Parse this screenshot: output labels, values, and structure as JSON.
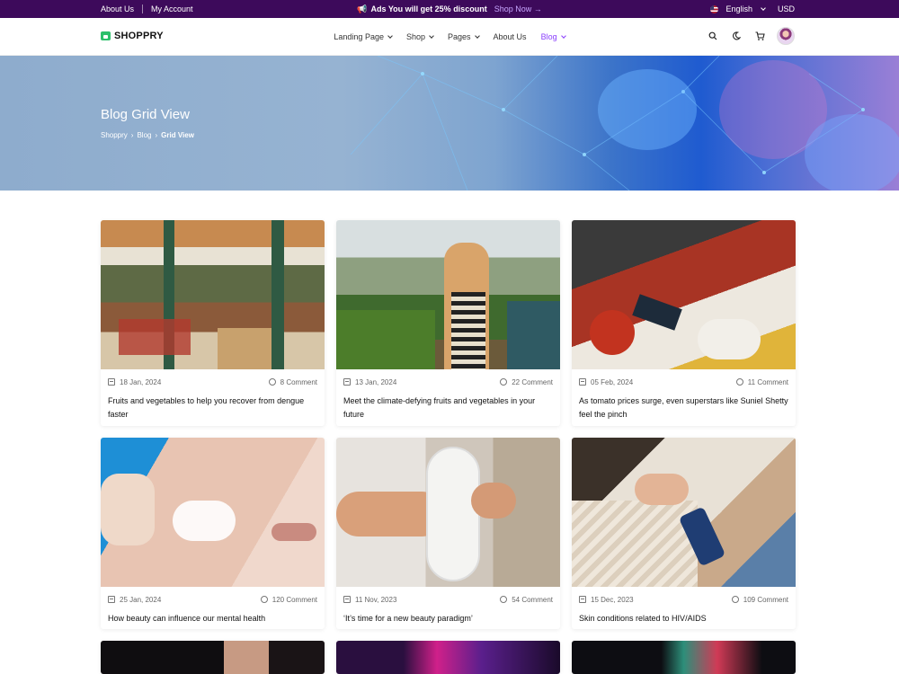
{
  "topbar": {
    "about": "About Us",
    "account": "My Account",
    "promo": "Ads You will get 25% discount",
    "shop_now": "Shop Now →",
    "language": "English",
    "currency": "USD"
  },
  "header": {
    "logo": "SHOPPRY",
    "nav": [
      "Landing Page",
      "Shop",
      "Pages",
      "About Us",
      "Blog"
    ],
    "accent": "#8a3ffc"
  },
  "hero": {
    "title": "Blog Grid View",
    "breadcrumb": [
      "Shoppry",
      "Blog",
      "Grid View"
    ]
  },
  "posts": [
    {
      "date": "18 Jan, 2024",
      "comments": "8 Comment",
      "title": "Fruits and vegetables to help you recover from dengue faster"
    },
    {
      "date": "13 Jan, 2024",
      "comments": "22 Comment",
      "title": "Meet the climate-defying fruits and vegetables in your future"
    },
    {
      "date": "05 Feb, 2024",
      "comments": "11 Comment",
      "title": "As tomato prices surge, even superstars like Suniel Shetty feel the pinch"
    },
    {
      "date": "25 Jan, 2024",
      "comments": "120 Comment",
      "title": "How beauty can influence our mental health"
    },
    {
      "date": "11 Nov, 2023",
      "comments": "54 Comment",
      "title": "‘It’s time for a new beauty paradigm’"
    },
    {
      "date": "15 Dec, 2023",
      "comments": "109 Comment",
      "title": "Skin conditions related to HIV/AIDS"
    }
  ]
}
